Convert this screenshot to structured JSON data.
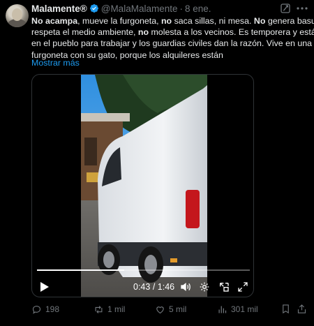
{
  "tweet": {
    "author_name": "Malamente®",
    "handle": "@MalaMalamente",
    "separator": "·",
    "date": "8 ene.",
    "text_lines": [
      [
        {
          "t": "No acampa",
          "b": true
        },
        {
          "t": ", mueve la furgoneta, ",
          "b": false
        },
        {
          "t": "no",
          "b": true
        },
        {
          "t": " saca sillas, ni mesa. ",
          "b": false
        },
        {
          "t": "No",
          "b": true
        },
        {
          "t": " genera basura,",
          "b": false
        }
      ],
      [
        {
          "t": "respeta el medio ambiente, ",
          "b": false
        },
        {
          "t": "no",
          "b": true
        },
        {
          "t": " molesta a los vecinos. Es temporera y está",
          "b": false
        }
      ],
      [
        {
          "t": "en el pueblo para trabajar y los guardias civiles dan la razón. Vive en una",
          "b": false
        }
      ],
      [
        {
          "t": "furgoneta con su gato, porque los alquileres están",
          "b": false
        }
      ]
    ],
    "show_more": "Mostrar más"
  },
  "video": {
    "current_time": "0:43",
    "time_separator": " / ",
    "duration": "1:46",
    "progress": 0.41
  },
  "actions": {
    "replies": "198",
    "reposts": "1 mil",
    "likes": "5 mil",
    "views": "301 mil"
  },
  "colors": {
    "background": "#000000",
    "text": "#e7e9ea",
    "muted": "#71767b",
    "link": "#1d9bf0",
    "verified": "#1d9bf0"
  },
  "icons": [
    "verified-badge-icon",
    "grok-icon",
    "more-icon",
    "play-icon",
    "volume-icon",
    "settings-icon",
    "pip-icon",
    "fullscreen-icon",
    "reply-icon",
    "repost-icon",
    "like-icon",
    "views-icon",
    "bookmark-icon",
    "share-icon"
  ]
}
